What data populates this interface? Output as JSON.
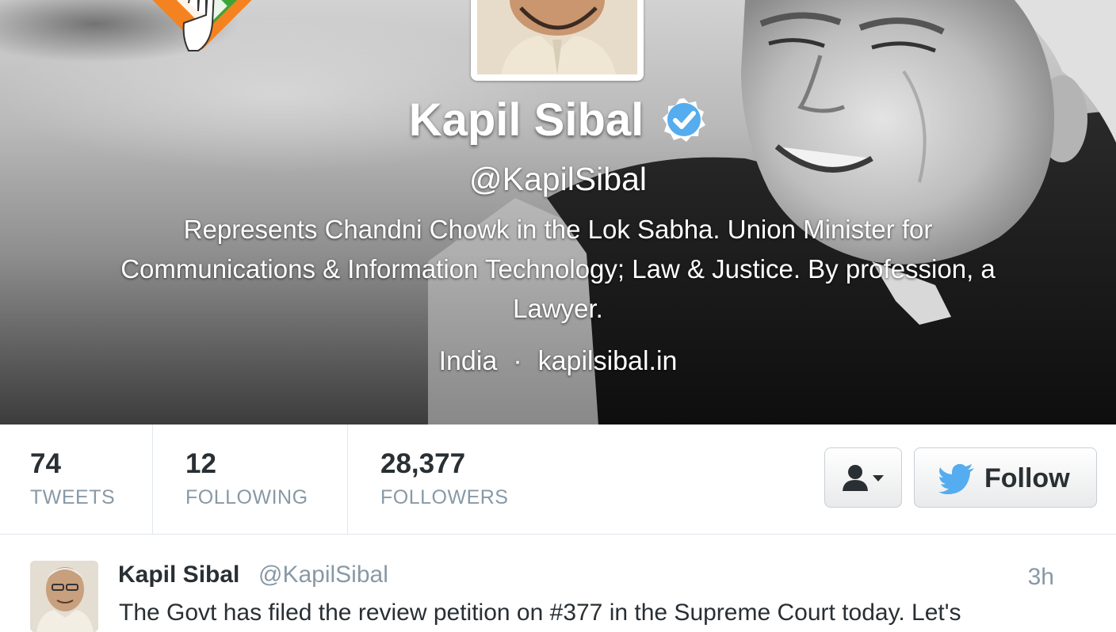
{
  "profile": {
    "name": "Kapil Sibal",
    "verified_icon": "verified-badge-icon",
    "handle": "@KapilSibal",
    "bio": "Represents Chandni Chowk in the Lok Sabha. Union Minister for Communications & Information Technology; Law & Justice. By profession, a Lawyer.",
    "location": "India",
    "separator": "·",
    "website": "kapilsibal.in"
  },
  "stats": [
    {
      "value": "74",
      "label": "TWEETS"
    },
    {
      "value": "12",
      "label": "FOLLOWING"
    },
    {
      "value": "28,377",
      "label": "FOLLOWERS"
    }
  ],
  "actions": {
    "user_menu_icon": "user-dropdown-icon",
    "follow_icon": "twitter-bird-icon",
    "follow_label": "Follow"
  },
  "tweet": {
    "name": "Kapil Sibal",
    "handle": "@KapilSibal",
    "time": "3h",
    "text": "The Govt has filed the review petition on #377 in the Supreme Court today. Let's"
  },
  "colors": {
    "verified": "#55acee",
    "twitter_blue": "#55acee",
    "text_dark": "#292f33",
    "text_muted": "#8899a6"
  }
}
